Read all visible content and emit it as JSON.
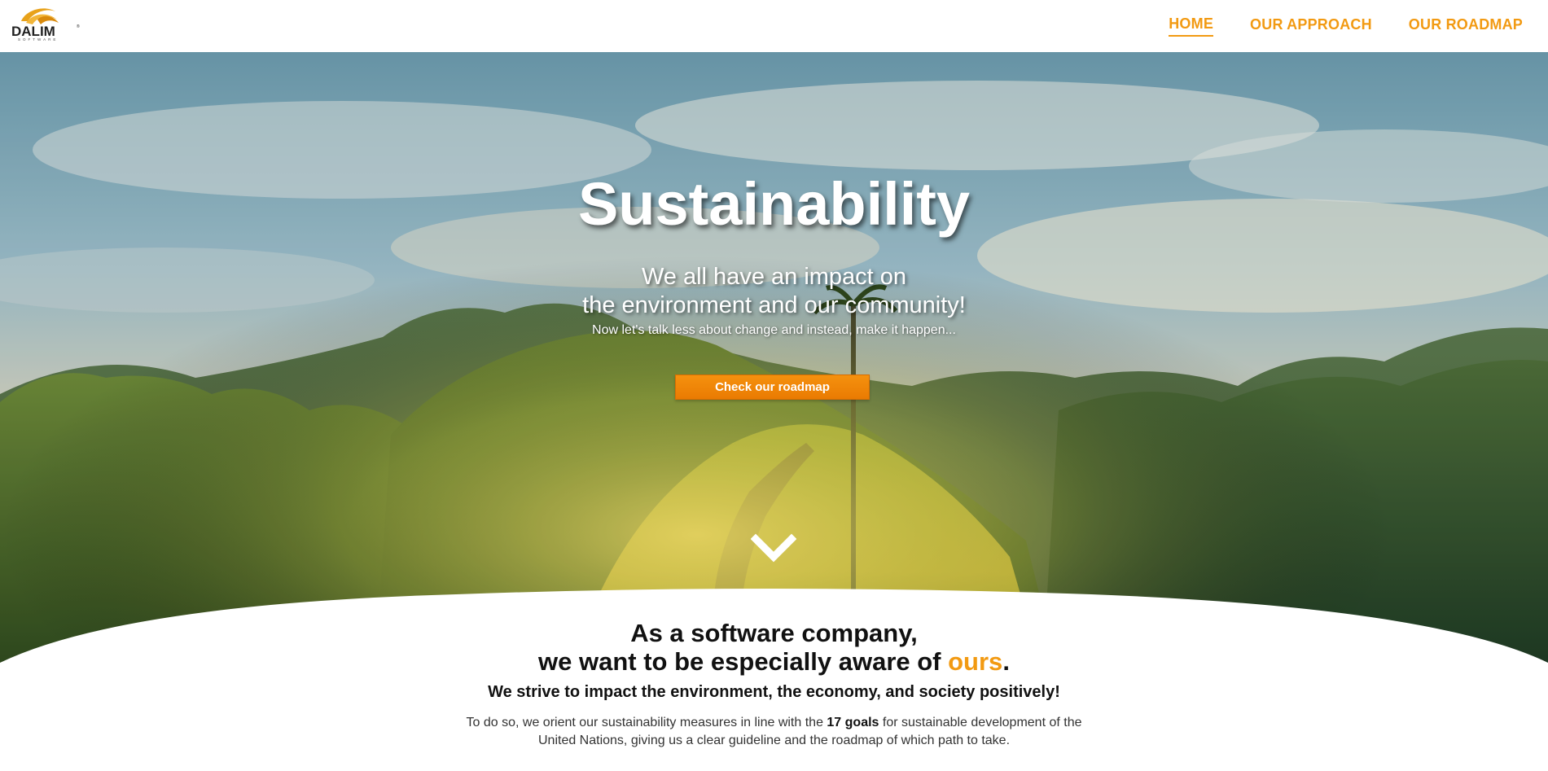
{
  "brand": {
    "logo_word": "DALIM",
    "logo_sub": "SOFTWARE",
    "colors": {
      "accent": "#f29a12",
      "button": "#f08a0a",
      "text": "#111111"
    }
  },
  "nav": {
    "items": [
      {
        "label": "HOME",
        "active": true
      },
      {
        "label": "OUR APPROACH",
        "active": false
      },
      {
        "label": "OUR ROADMAP",
        "active": false
      }
    ]
  },
  "hero": {
    "title": "Sustainability",
    "subtitle_line1": "We all have an impact on",
    "subtitle_line2": "the environment and our community!",
    "tagline": "Now let's talk less about change and instead, make it happen...",
    "cta_label": "Check our roadmap",
    "scroll_icon": "chevron-down-icon"
  },
  "intro": {
    "heading_line1": "As a software company,",
    "heading_line2_prefix": "we want to be especially aware of ",
    "heading_line2_accent": "ours",
    "heading_line2_suffix": ".",
    "subheading": "We strive to impact the environment, the economy, and society positively!",
    "body_prefix": "To do so, we orient our sustainability measures in line with the ",
    "body_bold": "17 goals",
    "body_suffix": " for sustainable development of the United Nations, giving us a clear guideline and the roadmap of which path to take."
  }
}
